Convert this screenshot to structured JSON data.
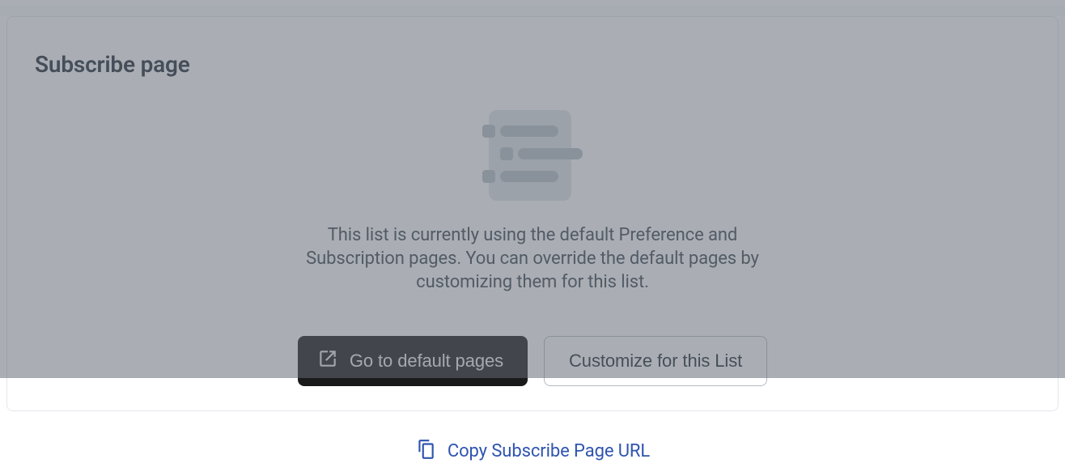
{
  "section": {
    "title": "Subscribe page",
    "description": "This list is currently using the default Preference and Subscription pages. You can override the default pages by customizing them for this list."
  },
  "buttons": {
    "go_default": "Go to default pages",
    "customize": "Customize for this List"
  },
  "copy_link": {
    "label": "Copy Subscribe Page URL"
  }
}
